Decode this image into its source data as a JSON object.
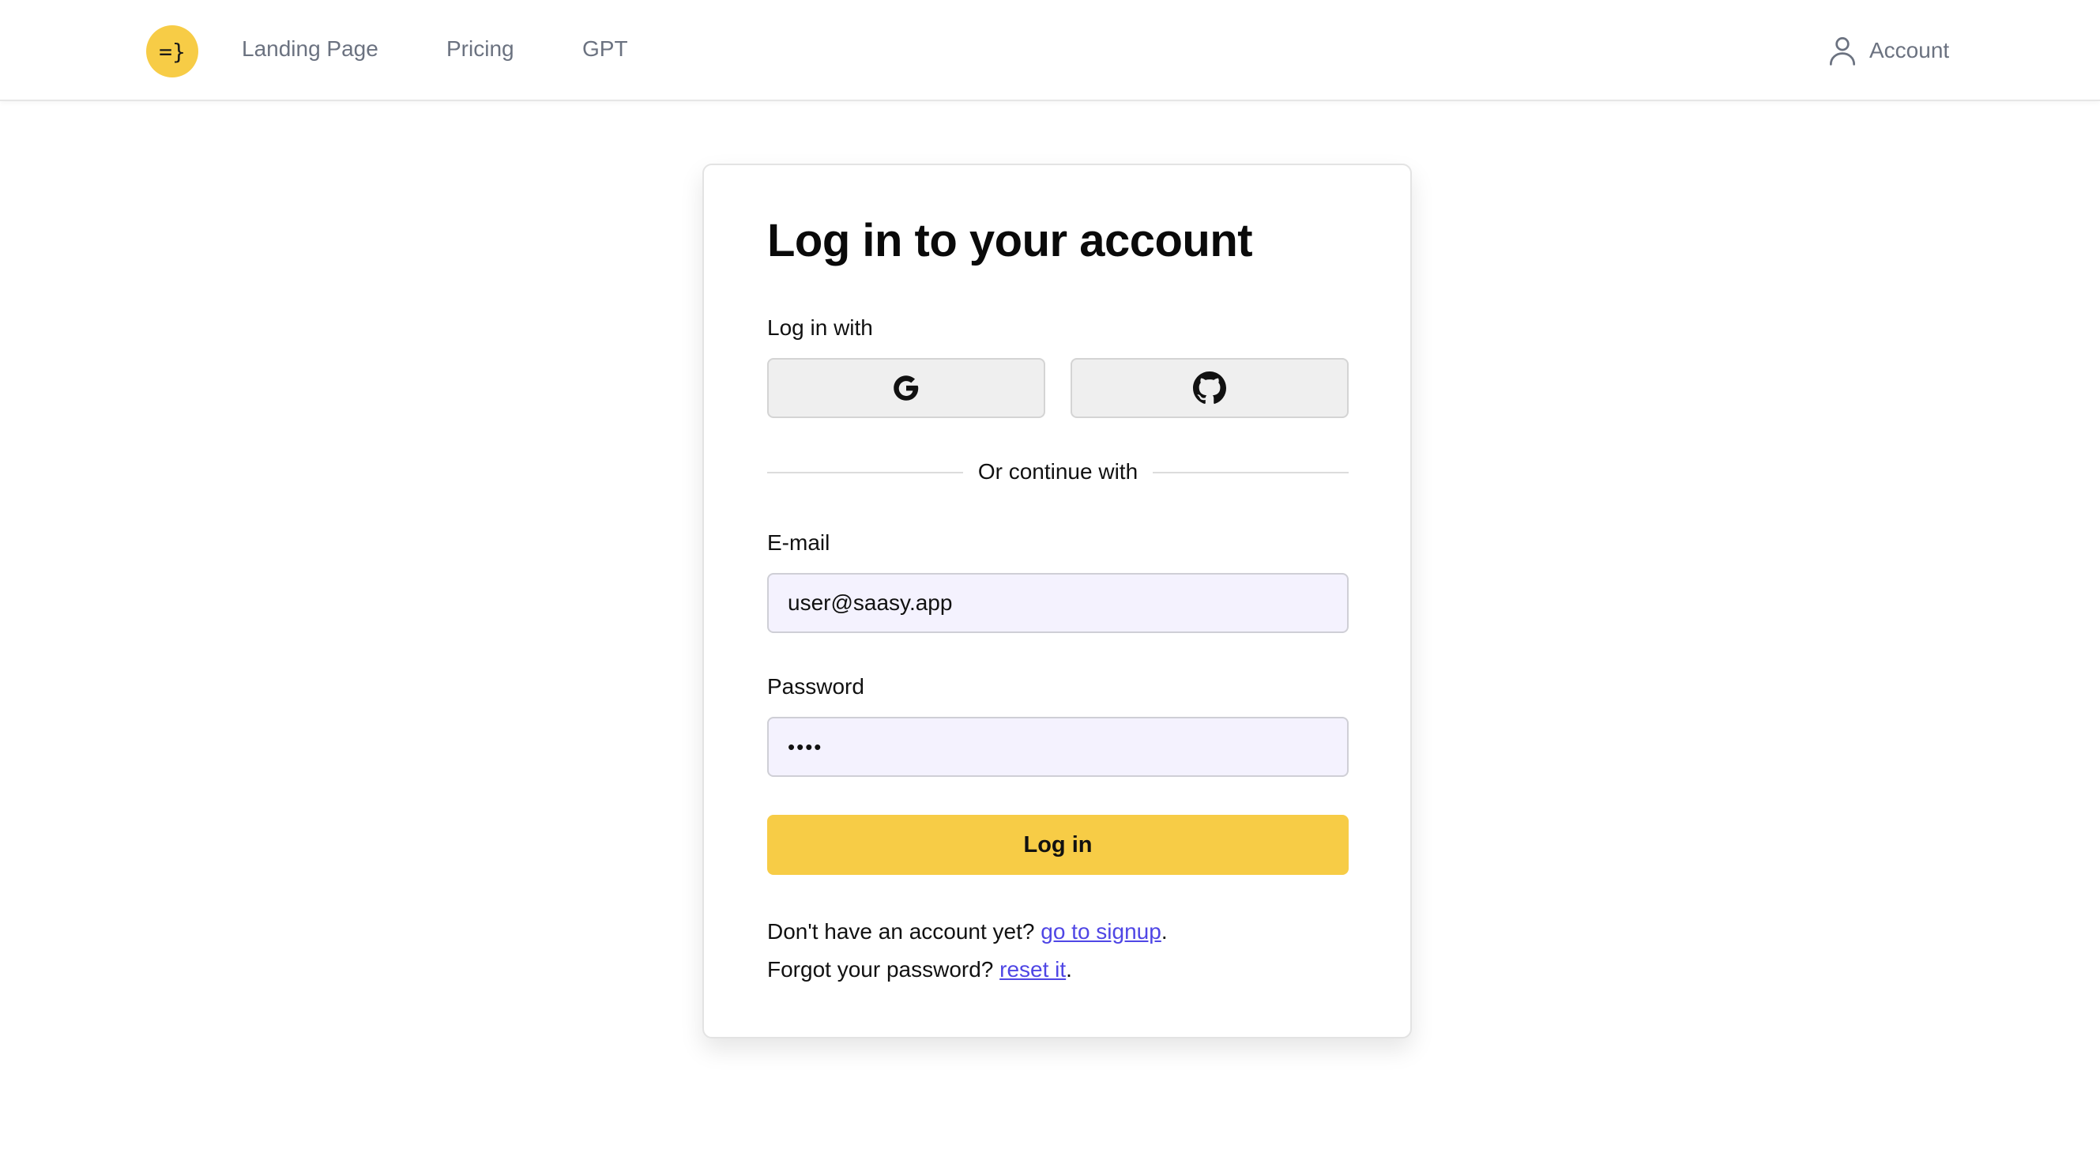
{
  "nav": {
    "logo_text": "=}",
    "links": [
      "Landing Page",
      "Pricing",
      "GPT"
    ],
    "account_label": "Account"
  },
  "login": {
    "title": "Log in to your account",
    "login_with_label": "Log in with",
    "providers": [
      {
        "name": "Google",
        "icon": "google-icon"
      },
      {
        "name": "GitHub",
        "icon": "github-icon"
      }
    ],
    "divider_text": "Or continue with",
    "email_label": "E-mail",
    "email_value": "user@saasy.app",
    "password_label": "Password",
    "password_value": "••••",
    "submit_label": "Log in",
    "signup_prompt": "Don't have an account yet? ",
    "signup_link": "go to signup",
    "forgot_prompt": "Forgot your password? ",
    "forgot_link": "reset it",
    "period": "."
  },
  "colors": {
    "accent": "#f7cc46",
    "link": "#4f46e5",
    "input_bg": "#f4f2fe",
    "nav_text": "#6b7280"
  }
}
